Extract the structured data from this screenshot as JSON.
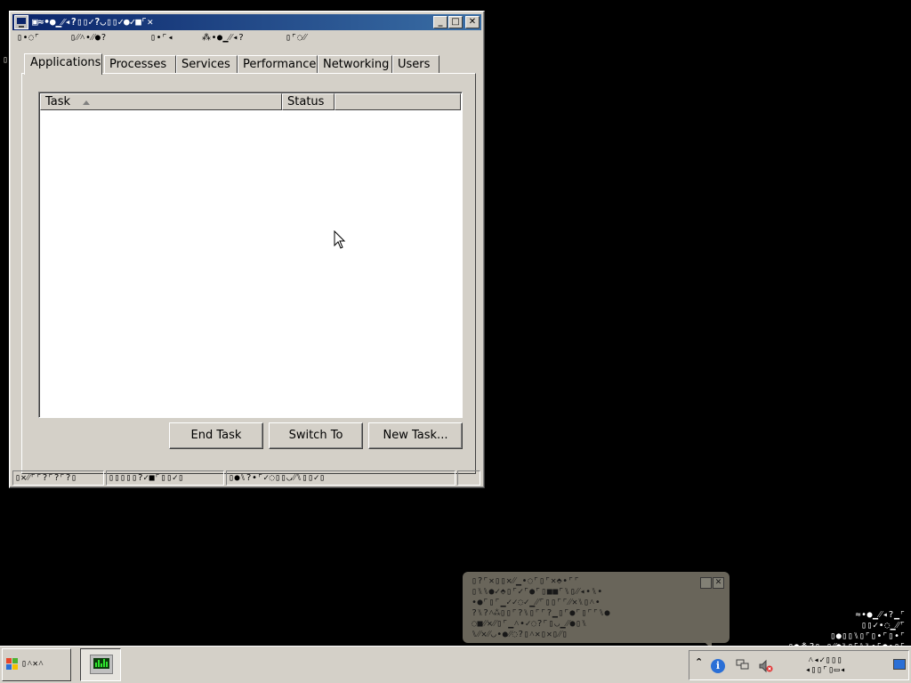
{
  "window": {
    "title": "▣≈•●▁⁄⁄◂?▯▯✓?◡▯▯✓●✓■⌜✕",
    "controls": {
      "minimize": "_",
      "maximize": "□",
      "close": "✕"
    }
  },
  "menu": [
    "▯•◌⌜",
    "▯⁄⁄˄•⁄⁄●?",
    "▯•⌜◂",
    "⁂•●▁⁄⁄◂?",
    "▯⌜◌⁄⁄"
  ],
  "tabs": [
    {
      "label": "Applications",
      "active": true
    },
    {
      "label": "Processes"
    },
    {
      "label": "Services"
    },
    {
      "label": "Performance"
    },
    {
      "label": "Networking"
    },
    {
      "label": "Users"
    }
  ],
  "task_list": {
    "columns": [
      "Task",
      "Status",
      ""
    ],
    "sort_column": "Task",
    "rows": []
  },
  "buttons": {
    "end_task": "End Task",
    "switch_to": "Switch To",
    "new_task": "New Task..."
  },
  "status_bar": [
    "▯✕⁄⁄⌜⌜?⌜?⌜?▯",
    "▯▯▯▯▯?✓■⌜▯▯✓▯",
    "▯●⑊?•⌜✓◌▯▯◡⁄⁄⑊▯▯✓▯",
    ""
  ],
  "stray_mark": "▯",
  "balloon": {
    "lines": [
      "▯?⌜✕▯▯✕⁄⁄▁•◌⌜▯⌜✕⬘•⌜⌜",
      "▯⑊⑊●✓⬘▯⌜✓⌜●⌜▯■■⌜⑊▯⁄⁄◂•⑊•",
      "•●⌜▯⌜▁✓✓◌✓▁⁄⁄⌜▯▯⌜⌜⁄⁄✕⑊▯˄•",
      "?⑊?˄⁂▯▯⌜?⑊▯⌜⌜?▁▯⌜●⌜▯⌜⌜⑊●",
      "◌■⁄⁄✕⁄⁄▯⌜▁˄•✓◌?⌜▯◡▁⁄⁄●▯⑊",
      "⑊⁄⁄✕⁄⁄◡•●⁄⁄◌?▯˄✕▯✕▯⁄⁄▯"
    ],
    "pin": "",
    "close": "✕"
  },
  "desktop_text": [
    "≈•●▁⁄⁄◂?▁⌜",
    "▯▯✓•◌▁⁄⁄⌜",
    "▯●▯▯⑊▯⌜▯•⌜▯•⌜",
    "▯●⁂?▯▁▯⁄⁄●⑊▯⌜⑊⑊•⌜●•▯⌜"
  ],
  "taskbar": {
    "start_label": "▯˄✕˄",
    "tray": {
      "expand": "⌃",
      "info": "i",
      "clock_lines": [
        "˄◂✓▯▯▯",
        "◂▯▯⌜▯▭◂"
      ]
    }
  }
}
